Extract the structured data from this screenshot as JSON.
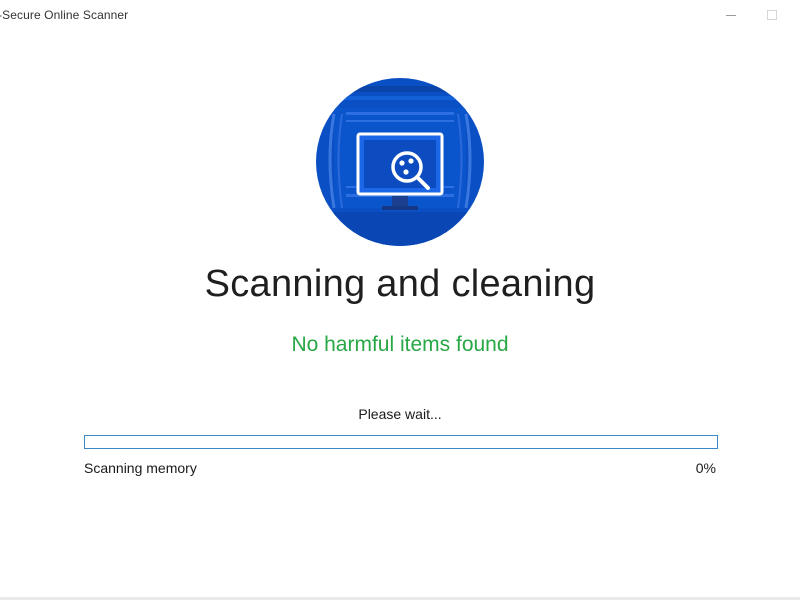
{
  "window": {
    "title": "-Secure Online Scanner"
  },
  "hero": {
    "icon": "scanner-monitor-magnifier-icon",
    "colors": {
      "circle": "#0a4fc4",
      "stripe_light": "#2f6fe0",
      "monitor": "#1c66e8",
      "screen": "#0d4cc0"
    }
  },
  "main": {
    "heading": "Scanning and cleaning",
    "status": "No harmful items found",
    "status_color": "#28a745",
    "wait_text": "Please wait..."
  },
  "progress": {
    "percent": 0,
    "percent_label": "0%",
    "label": "Scanning memory",
    "color": "#3c87c8"
  }
}
